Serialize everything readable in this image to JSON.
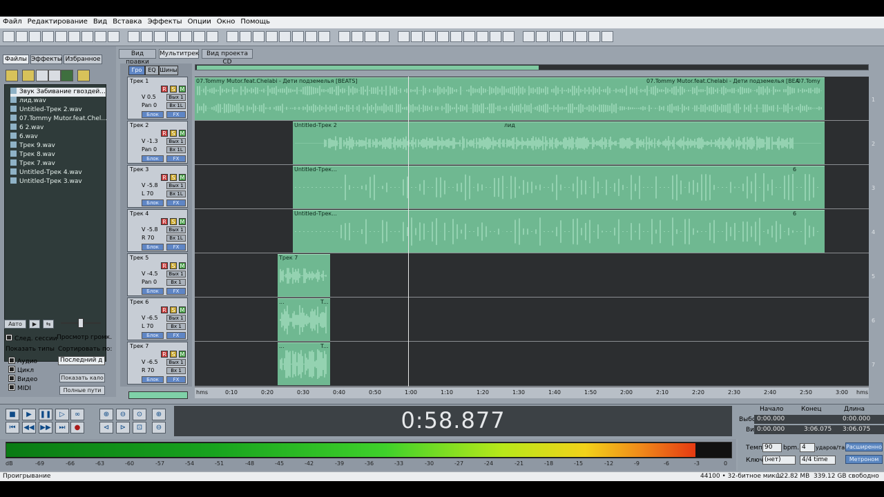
{
  "menu": [
    "Файл",
    "Редактирование",
    "Вид",
    "Вставка",
    "Эффекты",
    "Опции",
    "Окно",
    "Помощь"
  ],
  "left_tabs": [
    "Файлы",
    "Эффекты",
    "Избранное"
  ],
  "files": [
    "Звук Забивание гвоздей...",
    "лид.wav",
    "Untitled-Трек 2.wav",
    "07.Tommy Mutor.feat.Chel...",
    "6 2.wav",
    "6.wav",
    "Трек 9.wav",
    "Трек 8.wav",
    "Трек 7.wav",
    "Untitled-Трек 4.wav",
    "Untitled-Трек 3.wav"
  ],
  "left_controls": {
    "auto": "Авто",
    "play": "▶",
    "loop": "⇆",
    "sled_sessii": "След. сессии",
    "prosmotr": "Просмотр громк.",
    "pokazat_tipy": "Показать типы",
    "sortirovat": "Сортировать по:",
    "types": [
      "Аудио",
      "Цикл",
      "Видео",
      "MIDI"
    ],
    "sort_value": "Последний д",
    "show_btn": "Показать кало",
    "full_paths": "Полные пути"
  },
  "view_tabs": [
    "Вид правки",
    "Мультитрек",
    "Вид проекта CD"
  ],
  "mini_tabs": [
    "Гро",
    "EQ",
    "Шины"
  ],
  "tracks": [
    {
      "name": "Трек 1",
      "v": "V 0.5",
      "pan": "Pan 0",
      "out": "Вых 1",
      "in": "Вх 1L",
      "num": "1"
    },
    {
      "name": "Трек 2",
      "v": "V -1.3",
      "pan": "Pan 0",
      "out": "Вых 1",
      "in": "Вх 1L",
      "num": "2"
    },
    {
      "name": "Трек 3",
      "v": "V -5.8",
      "pan": "L 70",
      "out": "Вых 1",
      "in": "Вх 1L",
      "num": "3"
    },
    {
      "name": "Трек 4",
      "v": "V -5.8",
      "pan": "R 70",
      "out": "Вых 1",
      "in": "Вх 1L",
      "num": "4"
    },
    {
      "name": "Трек 5",
      "v": "V -4.5",
      "pan": "Pan 0",
      "out": "Вых 1",
      "in": "Вх 1",
      "num": "5"
    },
    {
      "name": "Трек 6",
      "v": "V -6.5",
      "pan": "L 70",
      "out": "Вых 1",
      "in": "Вх 1",
      "num": "6"
    },
    {
      "name": "Трек 7",
      "v": "V -6.5",
      "pan": "R 70",
      "out": "Вых 1",
      "in": "Вх 1",
      "num": "7"
    }
  ],
  "track_btn": {
    "r": "R",
    "s": "S",
    "m": "M",
    "block": "Блок",
    "fx": "FX"
  },
  "clips": {
    "t1": "07.Tommy Mutor.feat.Chelabi - Дети подземелья [BEATS]",
    "t1b": "07.Tommy Mutor.feat.Chelabi - Дети подземелья [BEA",
    "t1c": "07.Tomy",
    "t2": "Untitled-Трек 2",
    "t2b": "лид",
    "t3": "Untitled-Трек...",
    "t3b": "6",
    "t4": "Untitled-Трек...",
    "t4b": "6",
    "t5": "Трек 7",
    "t6": "...",
    "t6b": "T...",
    "t7": "...",
    "t7b": "T..."
  },
  "ruler": [
    "hms",
    "0:10",
    "0:20",
    "0:30",
    "0:40",
    "0:50",
    "1:00",
    "1:10",
    "1:20",
    "1:30",
    "1:40",
    "1:50",
    "2:00",
    "2:10",
    "2:20",
    "2:30",
    "2:40",
    "2:50",
    "3:00",
    "hms"
  ],
  "time_display": "0:58.877",
  "selection": {
    "headers": [
      "Начало",
      "Конец",
      "Длина"
    ],
    "row1_label": "Выбор",
    "row2_label": "Вид",
    "row1": [
      "0:00.000",
      "",
      "0:00.000"
    ],
    "row2": [
      "0:00.000",
      "3:06.075",
      "3:06.075"
    ]
  },
  "meter_labels": [
    "dB",
    "-69",
    "-66",
    "-63",
    "-60",
    "-57",
    "-54",
    "-51",
    "-48",
    "-45",
    "-42",
    "-39",
    "-36",
    "-33",
    "-30",
    "-27",
    "-24",
    "-21",
    "-18",
    "-15",
    "-12",
    "-9",
    "-6",
    "-3",
    "0"
  ],
  "tempo": {
    "label": "Темп",
    "value": "90",
    "bpm": "bpm.",
    "beats": "4",
    "beats_label": "ударов/так",
    "key_label": "Ключ",
    "key_value": "(нет)",
    "time_sig": "4/4 time",
    "ext_btn": "Расширенно",
    "metro_btn": "Метроном"
  },
  "status": {
    "left": "Проигрывание",
    "rate": "44100 • 32-битное микш",
    "mem": "122.82 MB",
    "disk": "339.12 GB свободно"
  },
  "playback_level": 0.95,
  "colors": {
    "clip": "#6fb891",
    "timeline_bg": "#2c2e30",
    "accent_blue": "#5a86c0"
  }
}
